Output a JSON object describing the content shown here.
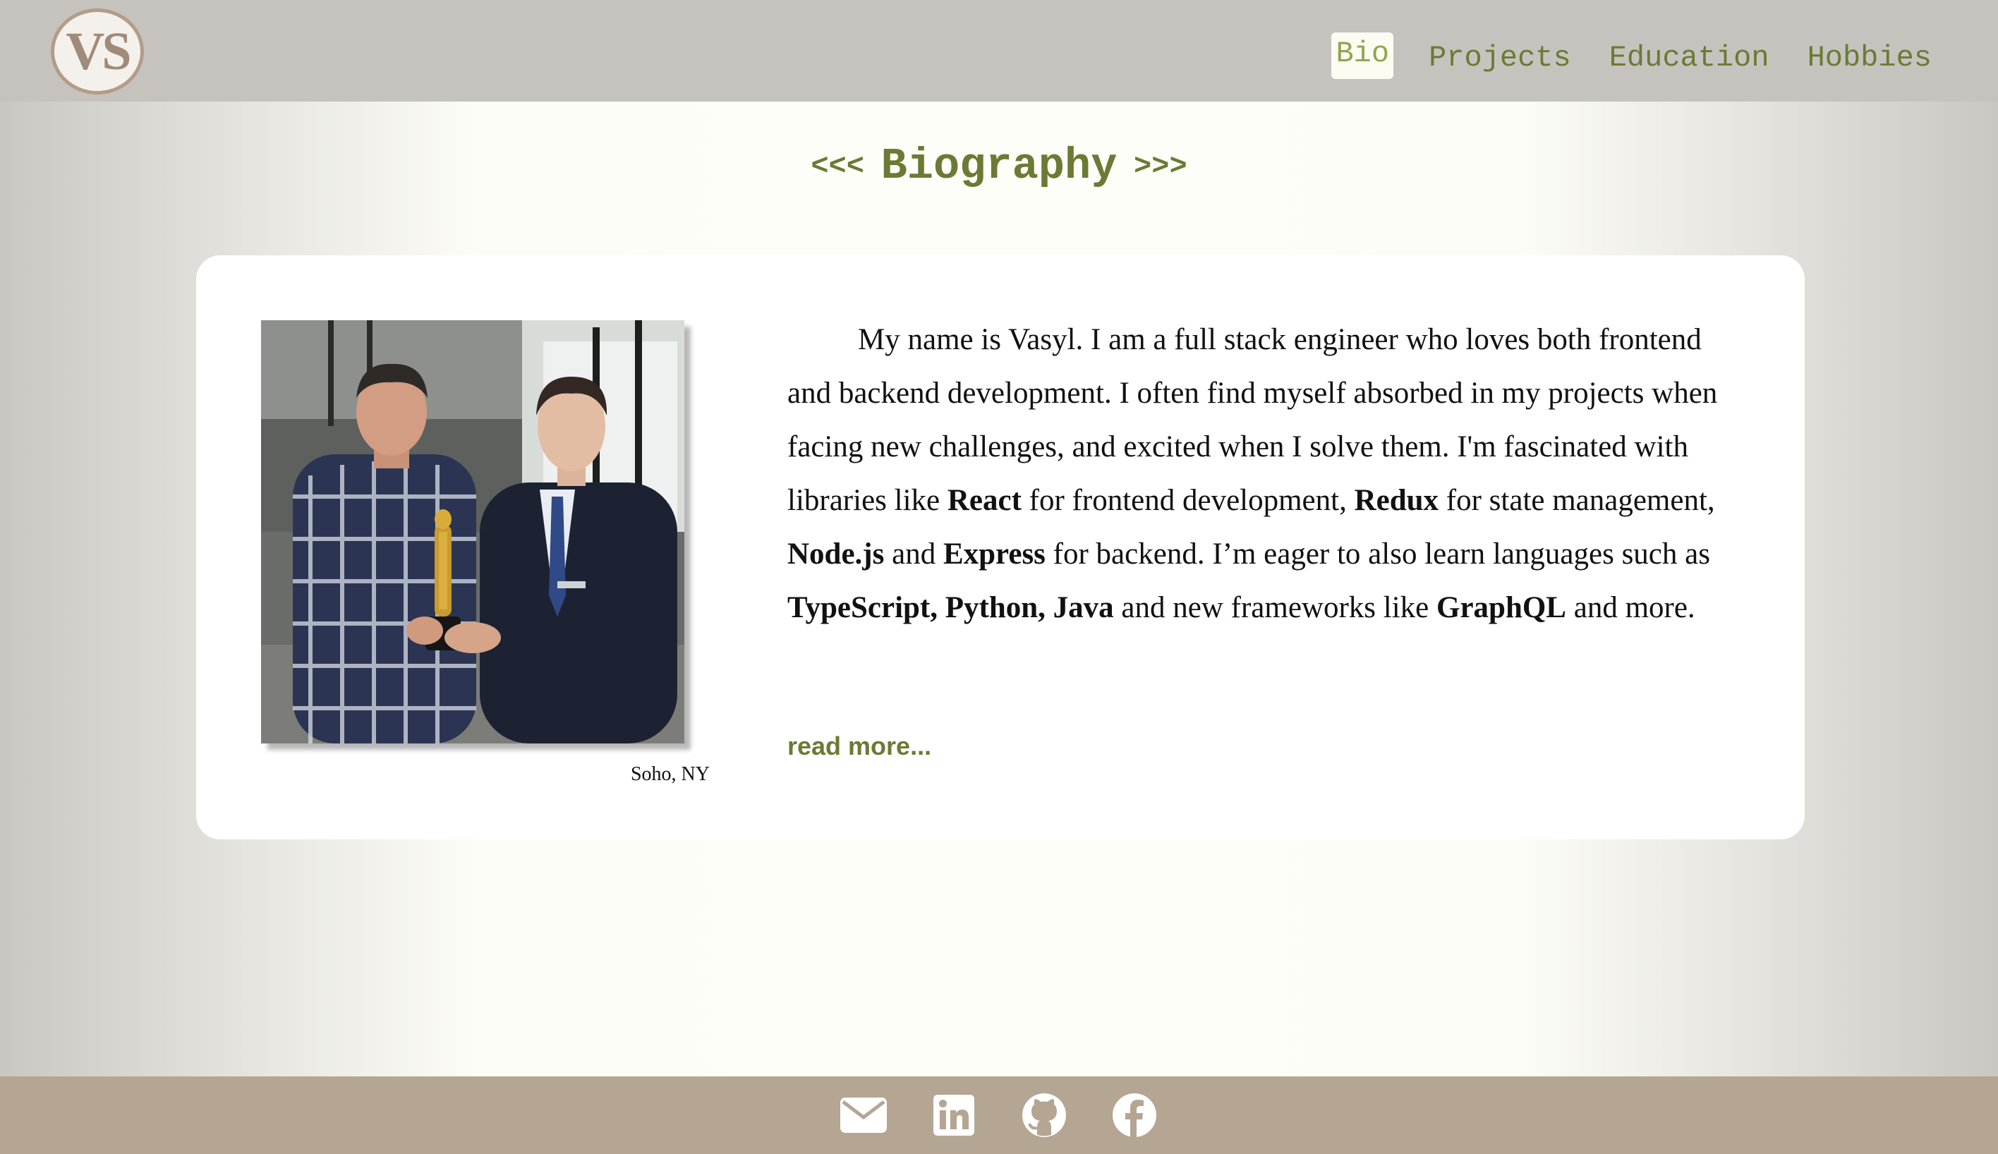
{
  "header": {
    "logo_text": "VS",
    "nav": [
      {
        "label": "Bio",
        "active": true
      },
      {
        "label": "Projects",
        "active": false
      },
      {
        "label": "Education",
        "active": false
      },
      {
        "label": "Hobbies",
        "active": false
      }
    ]
  },
  "main": {
    "heading_left": "<<<",
    "heading": "Biography",
    "heading_right": ">>>",
    "photo_caption": "Soho, NY",
    "bio": {
      "t1": "My name is Vasyl. I am a full stack engineer who loves both frontend and backend development. I often find myself absorbed in my projects when facing new challenges, and excited when I solve them. I'm fascinated with libraries like ",
      "b_react": "React",
      "t2": " for frontend development, ",
      "b_redux": "Redux",
      "t3": " for state management, ",
      "b_node": "Node.js",
      "t4": " and ",
      "b_express": "Express",
      "t5": " for backend. I’m eager to also learn languages such as ",
      "b_langs": "TypeScript, Python, Java",
      "t6": " and new frameworks like ",
      "b_graphql": "GraphQL",
      "t7": " and more."
    },
    "read_more": "read more..."
  },
  "footer": {
    "icons": [
      "envelope-icon",
      "linkedin-icon",
      "github-icon",
      "facebook-icon"
    ]
  },
  "colors": {
    "accent": "#6b7a34",
    "active_nav": "#8fa550",
    "header_bg": "#c6c3be",
    "footer_bg": "#b5a593",
    "logo_ring": "#b39c88"
  }
}
